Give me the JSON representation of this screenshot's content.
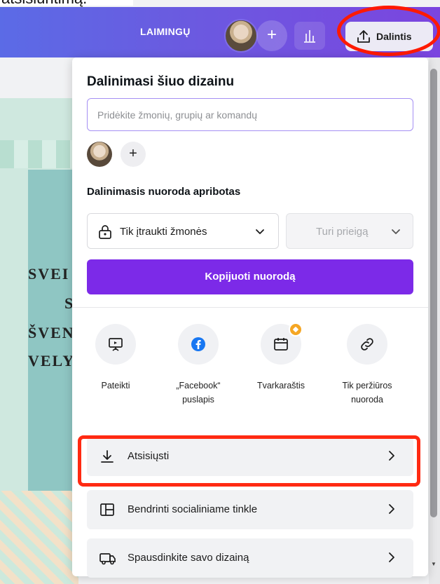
{
  "caption": "atsisiuntimą.",
  "header": {
    "team": "LAIMINGŲ",
    "add_member": "+",
    "share_label": "Dalintis"
  },
  "design_text": [
    "SVEI",
    "S",
    "ŠVEN",
    "VELY"
  ],
  "share_panel": {
    "title": "Dalinimasi šiuo dizainu",
    "invite_placeholder": "Pridėkite žmonių, grupių ar komandų",
    "add_people": "+",
    "link_heading": "Dalinimasis nuoroda apribotas",
    "access_value": "Tik įtraukti žmonės",
    "permission_value": "Turi prieigą",
    "copy_link_label": "Kopijuoti nuorodą",
    "options": [
      {
        "label": "Pateikti",
        "icon": "present-icon"
      },
      {
        "label": "„Facebook“ puslapis",
        "icon": "facebook-icon"
      },
      {
        "label": "Tvarkaraštis",
        "icon": "calendar-icon"
      },
      {
        "label": "Tik peržiūros nuoroda",
        "icon": "link-icon"
      }
    ],
    "actions": [
      {
        "label": "Atsisiųsti",
        "icon": "download-icon"
      },
      {
        "label": "Bendrinti socialiniame tinkle",
        "icon": "social-share-icon"
      },
      {
        "label": "Spausdinkite savo dizainą",
        "icon": "print-truck-icon"
      }
    ]
  },
  "colors": {
    "primary": "#7c2ae8",
    "highlight": "#ff2a12",
    "header_start": "#5b6be6",
    "header_end": "#7b45df"
  }
}
